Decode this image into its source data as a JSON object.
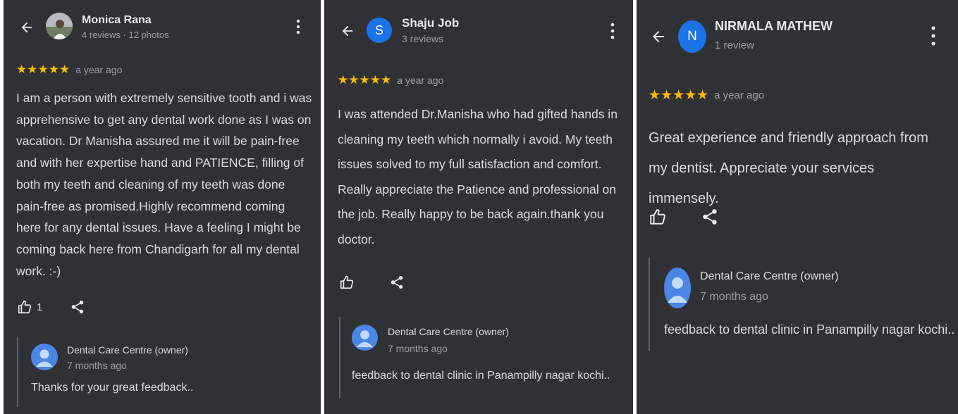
{
  "reviews": [
    {
      "reviewer_name": "Monica Rana",
      "reviewer_meta": "4 reviews · 12 photos",
      "avatar_type": "photo",
      "stars": "★★★★★",
      "rating": 5,
      "time": "a year ago",
      "text": "I am a person with extremely sensitive tooth and i was apprehensive to get any dental work done as I was on vacation. Dr Manisha assured me it will be pain-free and with her expertise hand and PATIENCE, filling of both my teeth and cleaning of my teeth was done pain-free as promised.Highly recommend coming here for any dental issues. Have a feeling I might be coming back here from Chandigarh for all my dental work. :-)",
      "like_count": "1",
      "owner": {
        "name": "Dental Care Centre (owner)",
        "time": "7 months ago",
        "text": "Thanks for your great feedback.."
      }
    },
    {
      "reviewer_name": "Shaju Job",
      "reviewer_meta": "3 reviews",
      "avatar_type": "letter",
      "avatar_letter": "S",
      "stars": "★★★★★",
      "rating": 5,
      "time": "a year ago",
      "text": "I was attended Dr.Manisha who had gifted hands in cleaning my teeth which normally i avoid. My teeth issues solved to my full satisfaction and comfort. Really appreciate the Patience and professional on the job. Really happy to be back again.thank you doctor.",
      "like_count": "",
      "owner": {
        "name": "Dental Care Centre (owner)",
        "time": "7 months ago",
        "text": "feedback to dental clinic in Panampilly nagar kochi.."
      }
    },
    {
      "reviewer_name": "NIRMALA MATHEW",
      "reviewer_meta": "1 review",
      "avatar_type": "letter",
      "avatar_letter": "N",
      "stars": "★★★★★",
      "rating": 5,
      "time": "a year ago",
      "text": "Great experience and friendly approach from my dentist. Appreciate your services immensely.",
      "like_count": "",
      "owner": {
        "name": "Dental Care Centre (owner)",
        "time": "7 months ago",
        "text": "feedback to dental clinic in Panampilly nagar kochi.."
      }
    }
  ],
  "icons": {
    "back": "back-arrow-icon",
    "more": "more-vertical-icon",
    "like": "thumbs-up-icon",
    "share": "share-icon",
    "owner_avatar": "person-icon"
  },
  "colors": {
    "panel_background": "#303134",
    "page_background": "#ffffff",
    "text_primary": "#e8eaed",
    "text_body": "#dadce0",
    "text_secondary": "#9aa0a6",
    "star": "#fbbc04",
    "avatar_blue": "#1a73e8",
    "owner_avatar": "#4a86e8",
    "reply_border": "#5f6368"
  }
}
